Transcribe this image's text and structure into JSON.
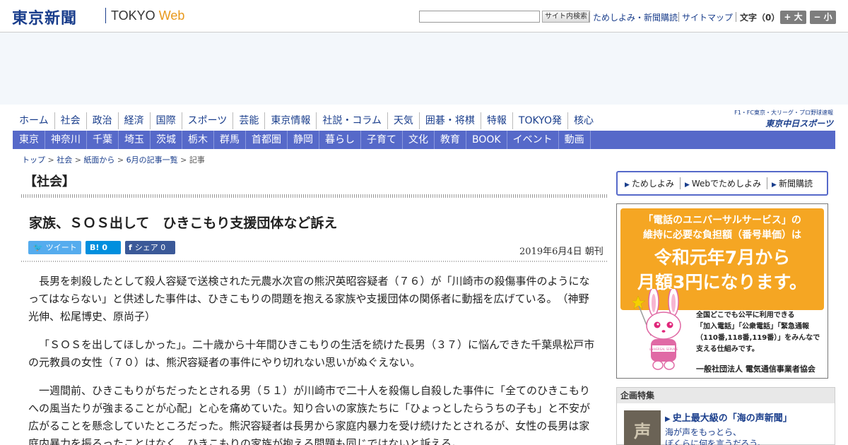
{
  "header": {
    "logo_jp": "東京新聞",
    "logo_tokyo": "TOKYO ",
    "logo_web": "Web",
    "search_placeholder": "",
    "search_button": "サイト内検索",
    "links": [
      "ためしよみ・新聞購読",
      "サイトマップ"
    ],
    "font_size_label": "文字（0）",
    "font_plus": "+ 大",
    "font_minus": "− 小"
  },
  "nav_primary": [
    "ホーム",
    "社会",
    "政治",
    "経済",
    "国際",
    "スポーツ",
    "芸能",
    "東京情報",
    "社説・コラム",
    "天気",
    "囲碁・将棋",
    "特報",
    "TOKYO発",
    "核心"
  ],
  "nav_secondary": [
    "東京",
    "神奈川",
    "千葉",
    "埼玉",
    "茨城",
    "栃木",
    "群馬",
    "首都圏",
    "静岡",
    "暮らし",
    "子育て",
    "文化",
    "教育",
    "BOOK",
    "イベント",
    "動画"
  ],
  "chunichi": {
    "top": "F1・FC東京・大リーグ・プロ野球速報",
    "bottom": "東京中日スポーツ"
  },
  "breadcrumb": [
    "トップ",
    "社会",
    "紙面から",
    "6月の記事一覧",
    "記事"
  ],
  "article": {
    "section": "【社会】",
    "headline": "家族、ＳＯＳ出して　ひきこもり支援団体など訴え",
    "share": {
      "tweet": "ツイート",
      "hatena_icon": "B!",
      "hatena_count": "0",
      "fb_icon": "f",
      "fb_label": "シェア",
      "fb_count": "0"
    },
    "date": "2019年6月4日 朝刊",
    "paragraphs": [
      "長男を刺殺したとして殺人容疑で送検された元農水次官の熊沢英昭容疑者（７６）が「川崎市の殺傷事件のようになってはならない」と供述した事件は、ひきこもりの問題を抱える家族や支援団体の関係者に動揺を広げている。　（神野光伸、松尾博史、原尚子）",
      "「ＳＯＳを出してほしかった」。二十歳から十年間ひきこもりの生活を続けた長男（３７）に悩んできた千葉県松戸市の元教員の女性（７０）は、熊沢容疑者の事件にやり切れない思いがぬぐえない。",
      "一週間前、ひきこもりがちだったとされる男（５１）が川崎市で二十人を殺傷し自殺した事件に「全てのひきこもりへの風当たりが強まることが心配」と心を痛めていた。知り合いの家族たちに「ひょっとしたらうちの子も」と不安が広がることを懸念していたところだった。熊沢容疑者は長男から家庭内暴力を受け続けたとされるが、女性の長男は家庭内暴力を振るったことはなく、ひきこもりの家族が抱える問題も同じではないと訴える。"
    ]
  },
  "sidebar": {
    "buttons": [
      "ためしよみ",
      "Webでためしよみ",
      "新聞購読"
    ],
    "ad": {
      "line1": "「電話のユニバーサルサービス」の",
      "line2": "維持に必要な負担額（番号単価）は",
      "line3": "令和元年7月から",
      "line4": "月額3円になります。",
      "small": [
        "全国どこでも公平に利用できる",
        "「加入電話」「公衆電話」「緊急通報",
        "（110番,118番,119番）」をみんなで",
        "支える仕組みです。"
      ],
      "org": "一般社団法人 電気通信事業者協会",
      "bunny_badge": "UNIVERSAL SERVICE"
    },
    "feature": {
      "heading": "企画特集",
      "thumb_text": "声",
      "title": "史上最大級の「海の声新聞」",
      "sub": [
        "海が声をもっとら、",
        "ぼくらに何を言うだろう。"
      ]
    }
  },
  "colors": {
    "brand": "#1a3e8c",
    "nav": "#5669c9",
    "accent": "#e8981b",
    "ad": "#f5a623"
  }
}
